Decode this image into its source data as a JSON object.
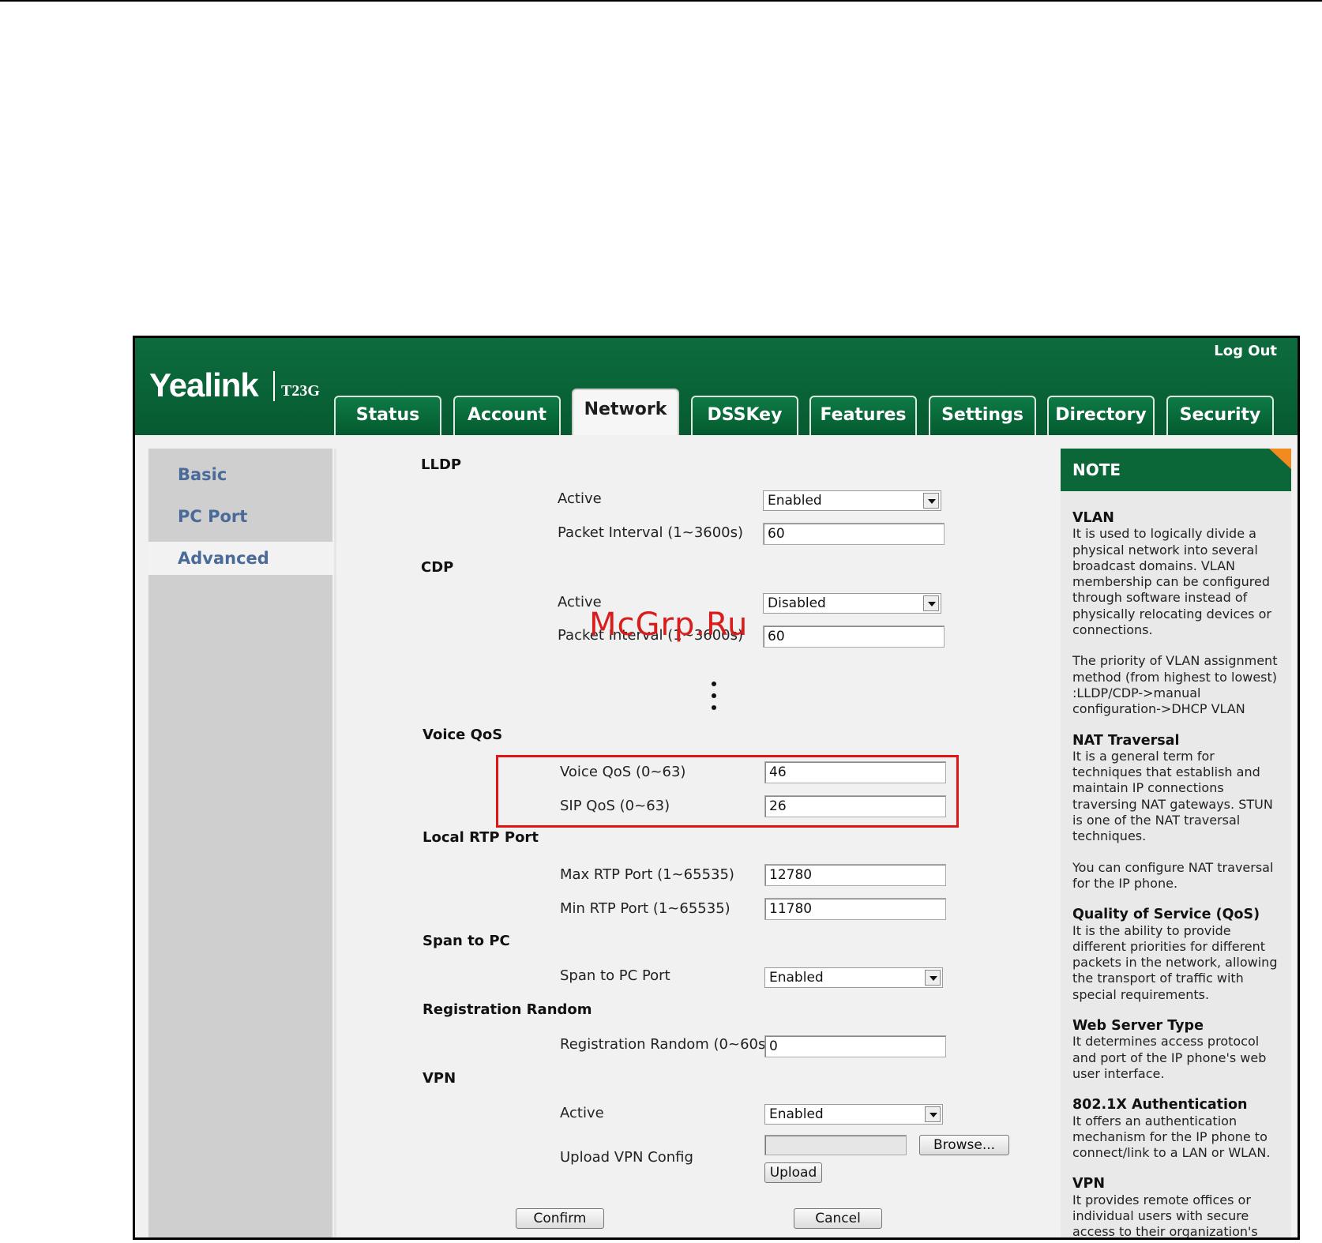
{
  "header": {
    "logo": "Yealink",
    "model": "T23G",
    "logout_label": "Log Out",
    "tabs": [
      {
        "label": "Status"
      },
      {
        "label": "Account"
      },
      {
        "label": "Network"
      },
      {
        "label": "DSSKey"
      },
      {
        "label": "Features"
      },
      {
        "label": "Settings"
      },
      {
        "label": "Directory"
      },
      {
        "label": "Security"
      }
    ],
    "active_tab": "Network"
  },
  "sidebar": {
    "items": [
      {
        "label": "Basic"
      },
      {
        "label": "PC Port"
      },
      {
        "label": "Advanced"
      }
    ],
    "active_item": "Advanced"
  },
  "main": {
    "lldp": {
      "title": "LLDP",
      "active_label": "Active",
      "active_value": "Enabled",
      "interval_label": "Packet Interval (1~3600s)",
      "interval_value": "60"
    },
    "cdp": {
      "title": "CDP",
      "active_label": "Active",
      "active_value": "Disabled",
      "interval_label": "Packet Interval (1~3600s)",
      "interval_value": "60"
    },
    "voice_qos": {
      "title": "Voice QoS",
      "voice_label": "Voice QoS (0~63)",
      "voice_value": "46",
      "sip_label": "SIP QoS (0~63)",
      "sip_value": "26"
    },
    "rtp": {
      "title": "Local RTP Port",
      "max_label": "Max RTP Port (1~65535)",
      "max_value": "12780",
      "min_label": "Min RTP Port (1~65535)",
      "min_value": "11780"
    },
    "span": {
      "title": "Span to PC",
      "port_label": "Span to PC Port",
      "port_value": "Enabled"
    },
    "reg_random": {
      "title": "Registration Random",
      "label": "Registration Random (0~60s)",
      "value": "0"
    },
    "vpn": {
      "title": "VPN",
      "active_label": "Active",
      "active_value": "Enabled",
      "upload_label": "Upload VPN Config",
      "browse_label": "Browse...",
      "upload_button": "Upload"
    },
    "confirm_label": "Confirm",
    "cancel_label": "Cancel"
  },
  "note": {
    "title": "NOTE",
    "sections": [
      {
        "heading": "VLAN",
        "text": "It is used to logically divide a physical network into several broadcast domains. VLAN membership can be configured through software instead of physically relocating devices or connections."
      },
      {
        "heading": "",
        "text": "The priority of VLAN assignment method (from highest to lowest) :LLDP/CDP->manual configuration->DHCP VLAN"
      },
      {
        "heading": "NAT Traversal",
        "text": "It is a general term for techniques that establish and maintain IP connections traversing NAT gateways. STUN is one of the NAT traversal techniques."
      },
      {
        "heading": "",
        "text": "You can configure NAT traversal for the IP phone."
      },
      {
        "heading": "Quality of Service (QoS)",
        "text": "It is the ability to provide different priorities for different packets in the network, allowing the transport of traffic with special requirements."
      },
      {
        "heading": "Web Server Type",
        "text": "It determines access protocol and port of the IP phone's web user interface."
      },
      {
        "heading": "802.1X Authentication",
        "text": "It offers an authentication mechanism for the IP phone to connect/link to a LAN or WLAN."
      },
      {
        "heading": "VPN",
        "text": "It provides remote offices or individual users with secure access to their organization's"
      }
    ]
  },
  "watermark": "McGrp.Ru",
  "colors": {
    "header_green": "#0a6639",
    "note_accent": "#f18a1f",
    "highlight_red": "#e01616",
    "sidebar_link": "#4a6a99"
  }
}
